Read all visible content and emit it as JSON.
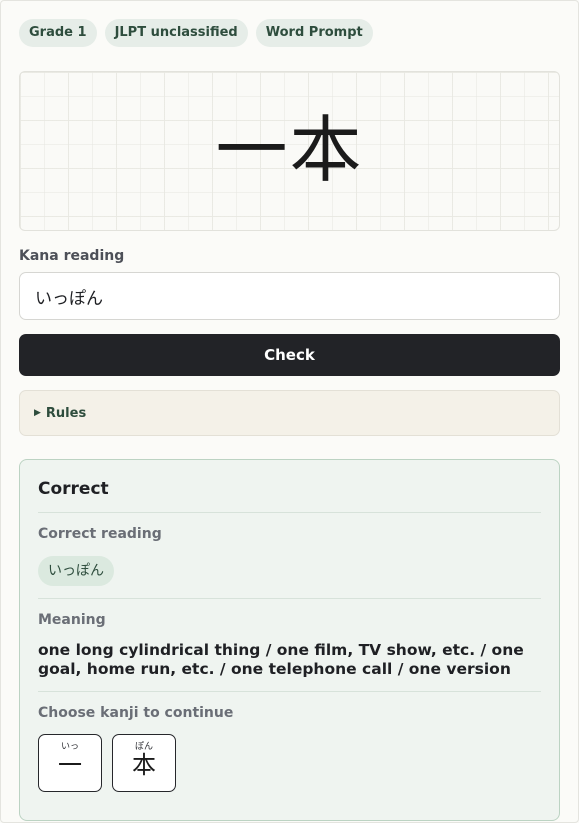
{
  "tags": [
    "Grade 1",
    "JLPT unclassified",
    "Word Prompt"
  ],
  "prompt": {
    "word": "一本"
  },
  "answer": {
    "label": "Kana reading",
    "value": "いっぽん",
    "check_label": "Check"
  },
  "rules": {
    "label": "Rules",
    "expanded": false
  },
  "result": {
    "status": "Correct",
    "correct_reading_label": "Correct reading",
    "correct_reading": "いっぽん",
    "meaning_label": "Meaning",
    "meaning": "one long cylindrical thing / one film, TV show, etc. / one goal, home run, etc. / one telephone call / one version",
    "choose_label": "Choose kanji to continue",
    "kanji_choices": [
      {
        "kanji": "一",
        "furigana": "いっ"
      },
      {
        "kanji": "本",
        "furigana": "ぽん"
      }
    ]
  },
  "colors": {
    "success_bg": "#eff4f0",
    "success_border": "#bcd3c3",
    "chip_bg": "#e6ede8",
    "primary_button": "#222327"
  }
}
